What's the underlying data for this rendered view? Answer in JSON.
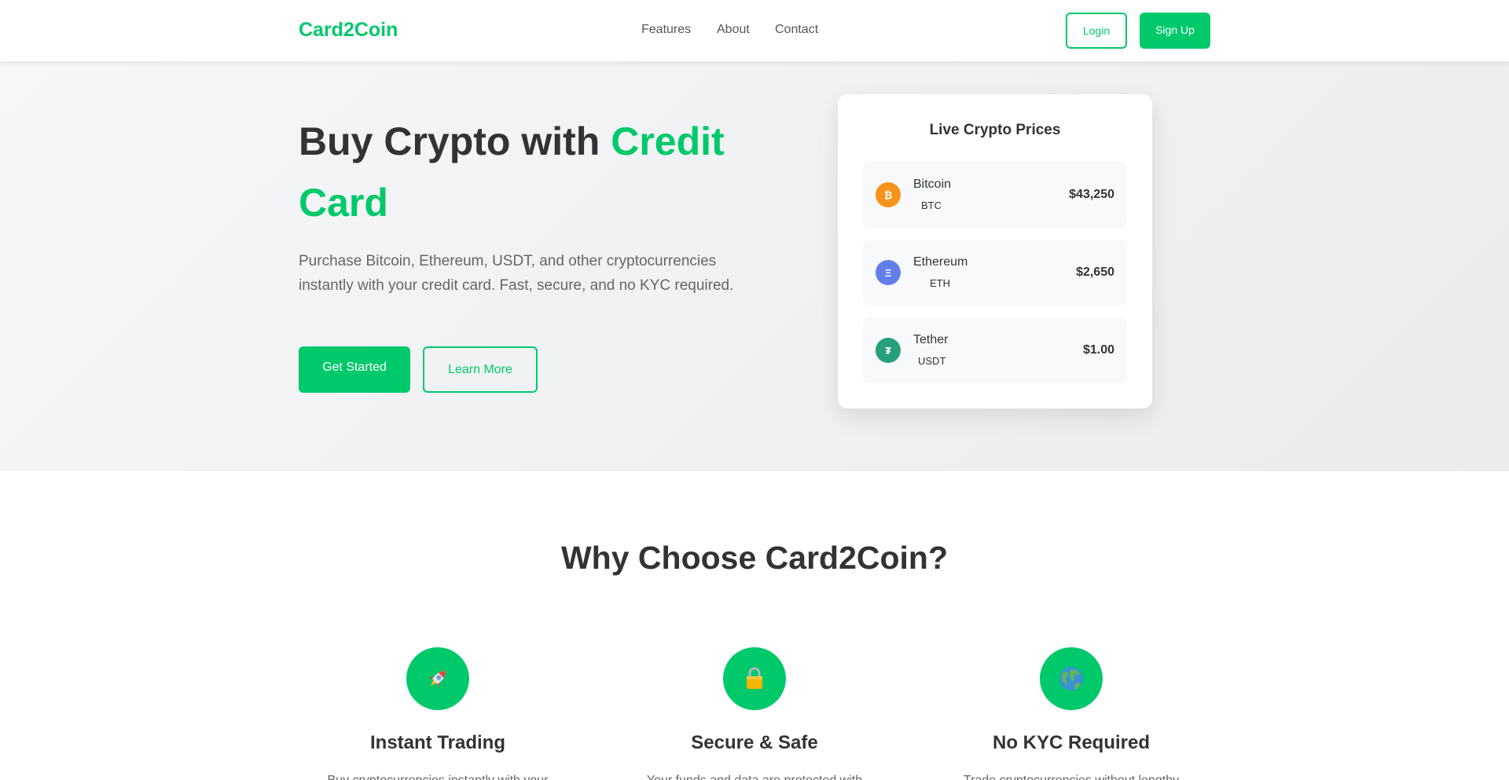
{
  "brand": {
    "name": "Card2Coin",
    "accent_color": "#00c96b"
  },
  "nav": {
    "links": [
      "Features",
      "About",
      "Contact"
    ],
    "login_label": "Login",
    "signup_label": "Sign Up"
  },
  "hero": {
    "title_prefix": "Buy Crypto with ",
    "title_accent": "Credit Card",
    "description": "Purchase Bitcoin, Ethereum, USDT, and other cryptocurrencies instantly with your credit card. Fast, secure, and no KYC required.",
    "primary_cta": "Get Started",
    "secondary_cta": "Learn More"
  },
  "prices": {
    "title": "Live Crypto Prices",
    "coins": [
      {
        "name": "Bitcoin",
        "symbol": "BTC",
        "price": "$43,250",
        "glyph": "₿",
        "color": "#f7931a",
        "icon": "bitcoin-icon"
      },
      {
        "name": "Ethereum",
        "symbol": "ETH",
        "price": "$2,650",
        "glyph": "Ξ",
        "color": "#627eea",
        "icon": "ethereum-icon"
      },
      {
        "name": "Tether",
        "symbol": "USDT",
        "price": "$1.00",
        "glyph": "₮",
        "color": "#26a17b",
        "icon": "tether-icon"
      }
    ]
  },
  "features": {
    "title": "Why Choose Card2Coin?",
    "items": [
      {
        "icon": "rocket-icon",
        "title": "Instant Trading",
        "description": "Buy cryptocurrencies instantly with your"
      },
      {
        "icon": "lock-icon",
        "title": "Secure & Safe",
        "description": "Your funds and data are protected with"
      },
      {
        "icon": "globe-icon",
        "title": "No KYC Required",
        "description": "Trade cryptocurrencies without lengthy"
      }
    ]
  }
}
